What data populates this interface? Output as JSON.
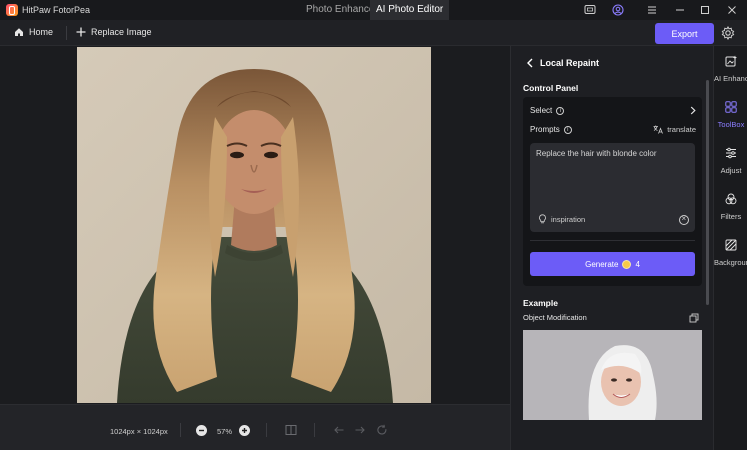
{
  "app": {
    "title": "HitPaw FotorPea",
    "modes": [
      "Photo Enhancer",
      "AI Photo Editor"
    ],
    "active_mode": "AI Photo Editor"
  },
  "toolbar": {
    "home_label": "Home",
    "replace_label": "Replace Image",
    "export_label": "Export"
  },
  "canvas": {
    "dimensions": "1024px × 1024px",
    "zoom": "57%"
  },
  "panel": {
    "title": "Local Repaint",
    "control_panel_label": "Control Panel",
    "select_label": "Select",
    "prompts_label": "Prompts",
    "translate_label": "translate",
    "prompt_value": "Replace the hair with blonde color",
    "inspiration_label": "inspiration",
    "generate_label": "Generate",
    "generate_cost": "4",
    "example_label": "Example",
    "example_type": "Object Modification"
  },
  "sidebar": {
    "items": [
      {
        "label": "AI Enhancer",
        "icon": "ai-enhance-icon"
      },
      {
        "label": "ToolBox",
        "icon": "toolbox-icon"
      },
      {
        "label": "Adjust",
        "icon": "adjust-icon"
      },
      {
        "label": "Filters",
        "icon": "filters-icon"
      },
      {
        "label": "Background",
        "icon": "background-icon"
      }
    ],
    "active": "ToolBox"
  },
  "colors": {
    "accent": "#6c5cf7",
    "active_text": "#8b7dff",
    "panel_bg": "#1e1f23"
  }
}
